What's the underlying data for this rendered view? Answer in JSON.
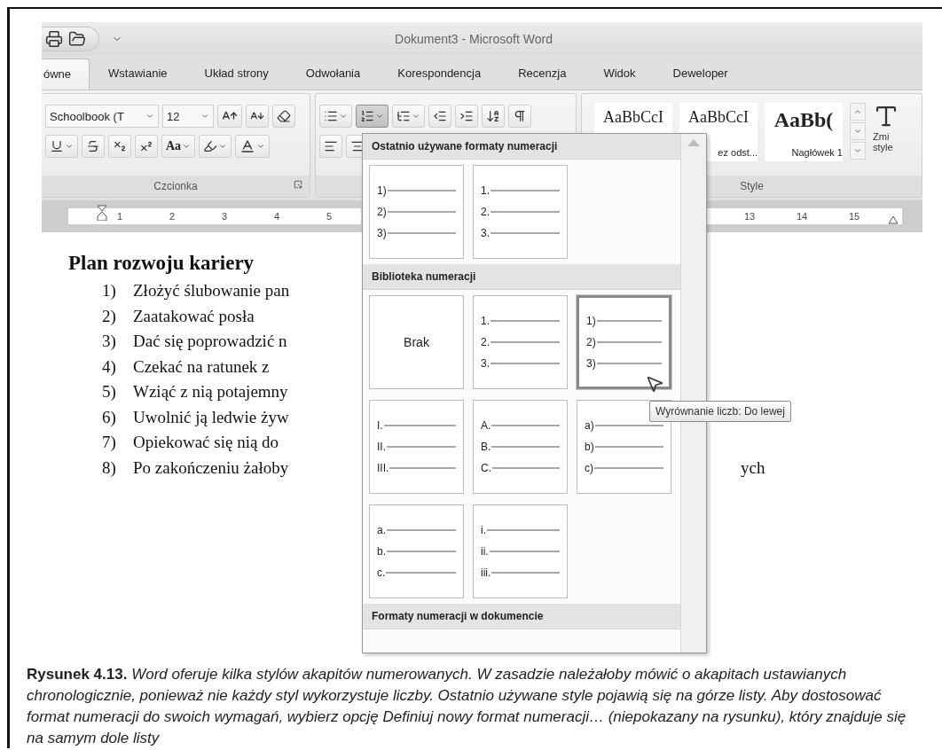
{
  "window": {
    "title": "Dokument3 - Microsoft Word"
  },
  "tabs": [
    {
      "label": "ówne",
      "selected": true
    },
    {
      "label": "Wstawianie",
      "selected": false
    },
    {
      "label": "Układ strony",
      "selected": false
    },
    {
      "label": "Odwołania",
      "selected": false
    },
    {
      "label": "Korespondencja",
      "selected": false
    },
    {
      "label": "Recenzja",
      "selected": false
    },
    {
      "label": "Widok",
      "selected": false
    },
    {
      "label": "Deweloper",
      "selected": false
    }
  ],
  "ribbon": {
    "font_group": {
      "label": "Czcionka",
      "font_name": "Schoolbook (T",
      "font_size": "12",
      "case_label": "Aa"
    },
    "paragraph_group": {
      "numbering_active": true
    },
    "styles_group": {
      "label": "Style",
      "gallery": [
        {
          "sample": "AaBbCcI"
        },
        {
          "sample": "AaBbCcI",
          "name": "ez odst..."
        },
        {
          "sample": "AaBb(",
          "name": "Nagłówek 1"
        }
      ],
      "change_styles": "Zmi style"
    }
  },
  "ruler": {
    "left_numbers": [
      "1",
      "2",
      "3",
      "4",
      "5"
    ],
    "right_numbers": [
      "13",
      "14",
      "15"
    ]
  },
  "document": {
    "heading": "Plan rozwoju kariery",
    "items": [
      {
        "number": "1)",
        "text": "Złożyć ślubowanie pan"
      },
      {
        "number": "2)",
        "text": "Zaatakować posła"
      },
      {
        "number": "3)",
        "text": "Dać się poprowadzić n"
      },
      {
        "number": "4)",
        "text": "Czekać na ratunek  z"
      },
      {
        "number": "5)",
        "text": "Wziąć z nią potajemny"
      },
      {
        "number": "6)",
        "text": "Uwolnić ją ledwie żyw"
      },
      {
        "number": "7)",
        "text": "Opiekować się nią do"
      },
      {
        "number": "8)",
        "text": "Po zakończeniu żałoby",
        "tail": "ych"
      }
    ]
  },
  "numbering_menu": {
    "sections": [
      {
        "title": "Ostatnio używane formaty numeracji",
        "tiles": [
          {
            "kind": "list",
            "markers": [
              "1)",
              "2)",
              "3)"
            ],
            "selected": false
          },
          {
            "kind": "list",
            "markers": [
              "1.",
              "2.",
              "3."
            ],
            "selected": false
          }
        ]
      },
      {
        "title": "Biblioteka numeracji",
        "tiles": [
          {
            "kind": "none",
            "label": "Brak",
            "selected": false
          },
          {
            "kind": "list",
            "markers": [
              "1.",
              "2.",
              "3."
            ],
            "selected": false
          },
          {
            "kind": "list",
            "markers": [
              "1)",
              "2)",
              "3)"
            ],
            "selected": true
          },
          {
            "kind": "list",
            "markers": [
              "I.",
              "II.",
              "III."
            ],
            "selected": false
          },
          {
            "kind": "list",
            "markers": [
              "A.",
              "B.",
              "C."
            ],
            "selected": false
          },
          {
            "kind": "list",
            "markers": [
              "a)",
              "b)",
              "c)"
            ],
            "selected": false
          },
          {
            "kind": "list",
            "markers": [
              "a.",
              "b.",
              "c."
            ],
            "selected": false
          },
          {
            "kind": "list",
            "markers": [
              "i.",
              "ii.",
              "iii."
            ],
            "selected": false
          }
        ]
      },
      {
        "title": "Formaty numeracji w dokumencie"
      }
    ]
  },
  "tooltip": "Wyrównanie liczb: Do lewej",
  "caption": "**Rysunek 4.13.** Word oferuje kilka stylów akapitów numerowanych. W zasadzie należałoby mówić o akapitach ustawianych chronologicznie, ponieważ nie każdy styl wykorzystuje liczby. Ostatnio używane style pojawią się na górze listy. Aby dostosować format numeracji do swoich wymagań, wybierz opcję Definiuj nowy format numeracji… (niepokazany na rysunku), który znajduje się na samym dole listy"
}
